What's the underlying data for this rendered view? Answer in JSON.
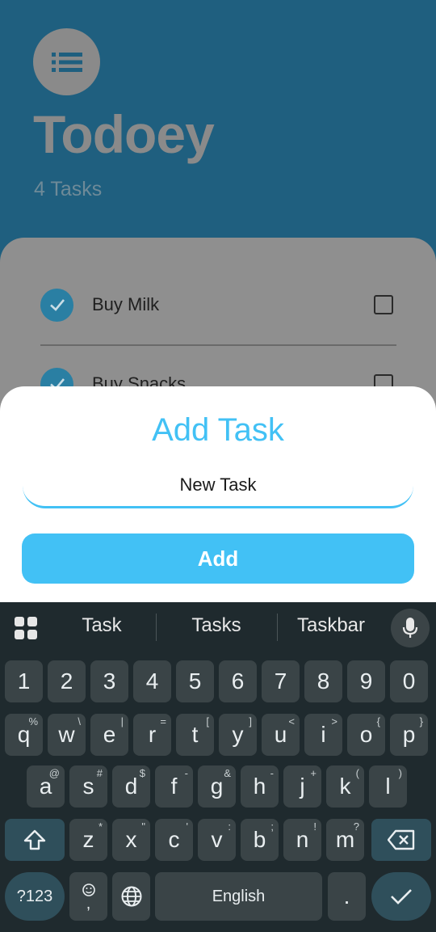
{
  "app": {
    "title": "Todoey",
    "task_count": "4 Tasks",
    "tasks": [
      {
        "label": "Buy Milk",
        "done": true
      },
      {
        "label": "Buy Snacks",
        "done": true
      }
    ]
  },
  "sheet": {
    "title": "Add Task",
    "input_value": "New Task",
    "add_label": "Add"
  },
  "keyboard": {
    "suggestions": [
      "Task",
      "Tasks",
      "Taskbar"
    ],
    "row_numbers": [
      "1",
      "2",
      "3",
      "4",
      "5",
      "6",
      "7",
      "8",
      "9",
      "0"
    ],
    "row_q": [
      [
        "q",
        "%"
      ],
      [
        "w",
        "\\"
      ],
      [
        "e",
        "|"
      ],
      [
        "r",
        "="
      ],
      [
        "t",
        "["
      ],
      [
        "y",
        "]"
      ],
      [
        "u",
        "<"
      ],
      [
        "i",
        ">"
      ],
      [
        "o",
        "{"
      ],
      [
        "p",
        "}"
      ]
    ],
    "row_a": [
      [
        "a",
        "@"
      ],
      [
        "s",
        "#"
      ],
      [
        "d",
        "$"
      ],
      [
        "f",
        "-"
      ],
      [
        "g",
        "&"
      ],
      [
        "h",
        "-"
      ],
      [
        "j",
        "+"
      ],
      [
        "k",
        "("
      ],
      [
        "l",
        ")"
      ]
    ],
    "row_z": [
      [
        "z",
        "*"
      ],
      [
        "x",
        "\""
      ],
      [
        "c",
        "'"
      ],
      [
        "v",
        ":"
      ],
      [
        "b",
        ";"
      ],
      [
        "n",
        "!"
      ],
      [
        "m",
        "?"
      ]
    ],
    "symbols_label": "?123",
    "emoji_sub": ",",
    "space_label": "English",
    "period_label": "."
  },
  "colors": {
    "accent": "#42c1f5",
    "header_bg": "#1f5f7f",
    "keyboard_bg": "#1f2a2e"
  }
}
